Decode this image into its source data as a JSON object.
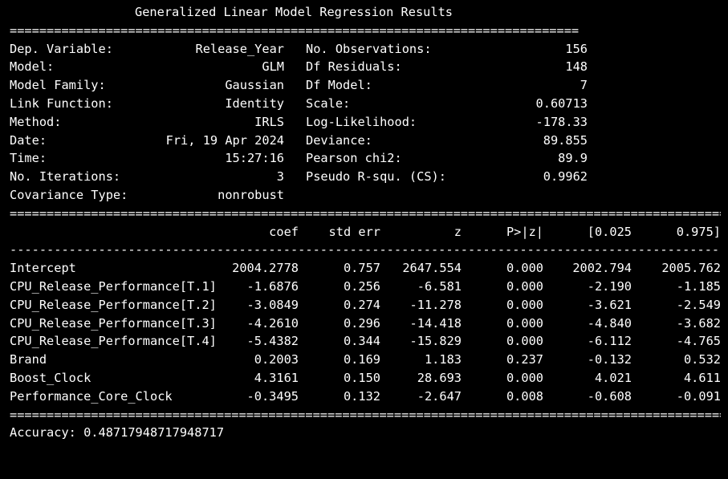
{
  "title": "Generalized Linear Model Regression Results",
  "rules": {
    "double_short": "=============================================================================",
    "double_long": "==================================================================================================",
    "dash_long": "--------------------------------------------------------------------------------------------------"
  },
  "summary": {
    "left": [
      {
        "label": "Dep. Variable:",
        "value": "Release_Year"
      },
      {
        "label": "Model:",
        "value": "GLM"
      },
      {
        "label": "Model Family:",
        "value": "Gaussian"
      },
      {
        "label": "Link Function:",
        "value": "Identity"
      },
      {
        "label": "Method:",
        "value": "IRLS"
      },
      {
        "label": "Date:",
        "value": "Fri, 19 Apr 2024"
      },
      {
        "label": "Time:",
        "value": "15:27:16"
      },
      {
        "label": "No. Iterations:",
        "value": "3"
      },
      {
        "label": "Covariance Type:",
        "value": "nonrobust"
      }
    ],
    "right": [
      {
        "label": "No. Observations:",
        "value": "156"
      },
      {
        "label": "Df Residuals:",
        "value": "148"
      },
      {
        "label": "Df Model:",
        "value": "7"
      },
      {
        "label": "Scale:",
        "value": "0.60713"
      },
      {
        "label": "Log-Likelihood:",
        "value": "-178.33"
      },
      {
        "label": "Deviance:",
        "value": "89.855"
      },
      {
        "label": "Pearson chi2:",
        "value": "89.9"
      },
      {
        "label": "Pseudo R-squ. (CS):",
        "value": "0.9962"
      }
    ]
  },
  "coef_table": {
    "headers": [
      "coef",
      "std err",
      "z",
      "P>|z|",
      "[0.025",
      "0.975]"
    ],
    "rows": [
      {
        "name": "Intercept",
        "coef": "2004.2778",
        "std_err": "0.757",
        "z": "2647.554",
        "p": "0.000",
        "lo": "2002.794",
        "hi": "2005.762"
      },
      {
        "name": "CPU_Release_Performance[T.1]",
        "coef": "-1.6876",
        "std_err": "0.256",
        "z": "-6.581",
        "p": "0.000",
        "lo": "-2.190",
        "hi": "-1.185"
      },
      {
        "name": "CPU_Release_Performance[T.2]",
        "coef": "-3.0849",
        "std_err": "0.274",
        "z": "-11.278",
        "p": "0.000",
        "lo": "-3.621",
        "hi": "-2.549"
      },
      {
        "name": "CPU_Release_Performance[T.3]",
        "coef": "-4.2610",
        "std_err": "0.296",
        "z": "-14.418",
        "p": "0.000",
        "lo": "-4.840",
        "hi": "-3.682"
      },
      {
        "name": "CPU_Release_Performance[T.4]",
        "coef": "-5.4382",
        "std_err": "0.344",
        "z": "-15.829",
        "p": "0.000",
        "lo": "-6.112",
        "hi": "-4.765"
      },
      {
        "name": "Brand",
        "coef": "0.2003",
        "std_err": "0.169",
        "z": "1.183",
        "p": "0.237",
        "lo": "-0.132",
        "hi": "0.532"
      },
      {
        "name": "Boost_Clock",
        "coef": "4.3161",
        "std_err": "0.150",
        "z": "28.693",
        "p": "0.000",
        "lo": "4.021",
        "hi": "4.611"
      },
      {
        "name": "Performance_Core_Clock",
        "coef": "-0.3495",
        "std_err": "0.132",
        "z": "-2.647",
        "p": "0.008",
        "lo": "-0.608",
        "hi": "-0.091"
      }
    ]
  },
  "accuracy": "Accuracy: 0.48717948717948717"
}
